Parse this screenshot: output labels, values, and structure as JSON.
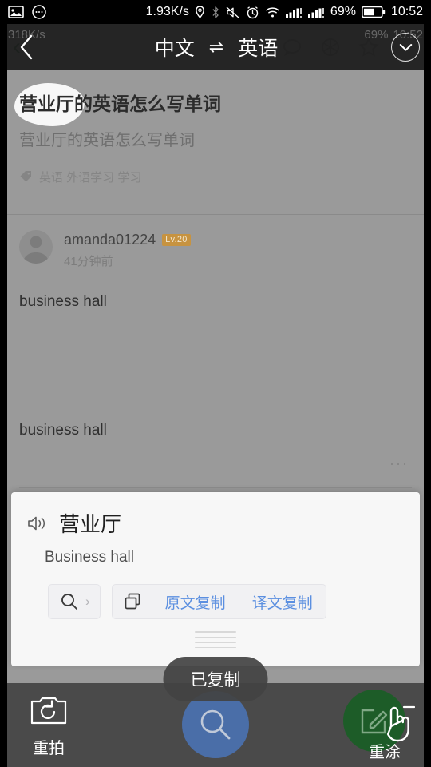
{
  "statusbar": {
    "left_icons": [
      "image-icon",
      "message-icon"
    ],
    "network_speed": "1.93K/s",
    "icons": [
      "location-icon",
      "bluetooth-icon",
      "mute-icon",
      "alarm-icon",
      "wifi-icon",
      "signal-icon",
      "signal-icon"
    ],
    "battery_percent": "69%",
    "time": "10:52"
  },
  "ghost_statusbar": {
    "network_speed": "318K/s",
    "battery_percent": "69%",
    "time": "10:52"
  },
  "overlay_header": {
    "back_icon": "chevron-left-icon",
    "source_lang": "中文",
    "swap_icon": "⇌",
    "target_lang": "英语",
    "collapse_icon": "chevron-down-icon"
  },
  "page": {
    "back_icon": "chevron-left-icon",
    "header_icons": [
      "chat-icon",
      "camera-icon",
      "star-icon",
      "more-icon"
    ],
    "article": {
      "title": "营业厅的英语怎么写单词",
      "subtitle": "营业厅的英语怎么写单词",
      "tag_icon": "tag-icon",
      "tags": "英语 外语学习 学习"
    },
    "author": {
      "avatar_icon": "user-avatar-icon",
      "name": "amanda01224",
      "level": "Lv.20",
      "time": "41分钟前"
    },
    "answers": [
      "business hall",
      "business hall"
    ],
    "more_icon": "···"
  },
  "translation_card": {
    "speaker_icon": "speaker-icon",
    "source_text": "营业厅",
    "target_text": "Business hall",
    "search_chip": {
      "icon": "search-icon",
      "chevron": "›"
    },
    "copy_icon": "copy-icon",
    "copy_source_label": "原文复制",
    "copy_target_label": "译文复制",
    "drag_handle": "drag-handle"
  },
  "toast": {
    "message": "已复制"
  },
  "bottombar": {
    "retake": {
      "icon": "camera-retake-icon",
      "label": "重拍"
    },
    "search": {
      "icon": "search-icon"
    },
    "repaint": {
      "icon": "edit-square-icon",
      "label": "重涂"
    },
    "cursor": "hand-pointer-icon"
  },
  "colors": {
    "accent_blue": "#5b8fe0",
    "search_button": "#4a6ea8",
    "repaint_green": "#1d5c28",
    "level_badge": "#c79340",
    "card_bg": "#f7f7f7",
    "page_bg": "#9a9a9a",
    "bottombar_bg": "#4a4a4a"
  }
}
